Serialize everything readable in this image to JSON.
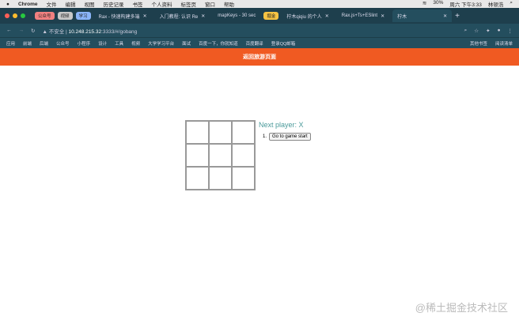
{
  "menubar": {
    "app": "Chrome",
    "items": [
      "文件",
      "编辑",
      "视图",
      "历史记录",
      "书签",
      "个人资料",
      "标签页",
      "窗口",
      "帮助"
    ],
    "battery": "30%",
    "clock": "周六 下午3:33",
    "user": "林顿浩"
  },
  "tab_groups": [
    {
      "label": "公众号",
      "color": "#f08080"
    },
    {
      "label": "视频",
      "color": "#c8c8c8"
    },
    {
      "label": "学习",
      "color": "#8ab4f8"
    }
  ],
  "tabs": [
    "Rax - 快速构建多端",
    "入门教程: 认识 Re",
    "mapKeys - 30 sec",
    "柠木qiqiu 的个人",
    "Rax.js+Ts+ESlint",
    "柠木"
  ],
  "tab_group2": {
    "label": "掘金",
    "color": "#f6c343"
  },
  "address": {
    "security": "不安全",
    "host": "10.248.215.32",
    "path": ":3333/#/gobang"
  },
  "bookmarks": [
    "应用",
    "前端",
    "后端",
    "公众号",
    "小程序",
    "设计",
    "工具",
    "视频",
    "大学学习平台",
    "面试",
    "百度一下，你就知道",
    "百度翻译",
    "登录QQ邮箱"
  ],
  "bookmarks_right": [
    "其他书签",
    "阅读清单"
  ],
  "banner": "返回旅游页面",
  "game": {
    "status": "Next player: X",
    "moves": [
      {
        "index": "1.",
        "label": "Go to game start"
      }
    ],
    "squares": [
      "",
      "",
      "",
      "",
      "",
      "",
      "",
      "",
      ""
    ]
  },
  "watermark": "@稀土掘金技术社区"
}
